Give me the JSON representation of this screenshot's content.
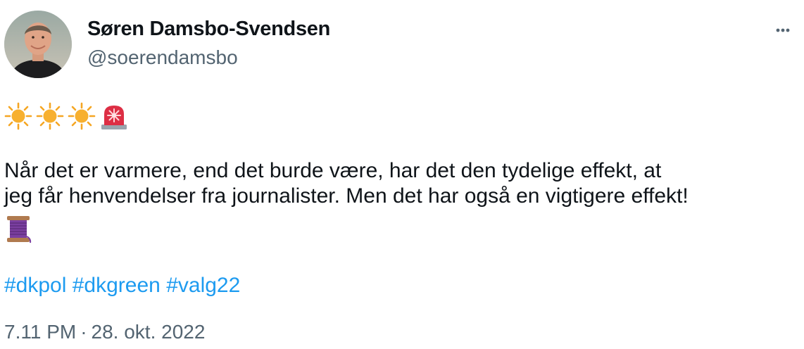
{
  "author": {
    "display_name": "Søren Damsbo-Svendsen",
    "handle": "@soerendamsbo"
  },
  "tweet": {
    "lead_emojis": [
      "sun-icon",
      "sun-icon",
      "sun-icon",
      "rotating-light-icon"
    ],
    "text_line1": "Når det er varmere, end det burde være, har det den tydelige effekt, at",
    "text_line2": "jeg får henvendelser fra journalister. Men det har også en vigtigere effekt!",
    "trailing_emoji": "spool-of-thread-icon",
    "hashtags": [
      "#dkpol",
      "#dkgreen",
      "#valg22"
    ],
    "time": "7.11 PM",
    "separator": "·",
    "date": "28. okt. 2022"
  },
  "colors": {
    "text": "#0f1419",
    "secondary": "#536471",
    "link": "#1d9bf0"
  }
}
